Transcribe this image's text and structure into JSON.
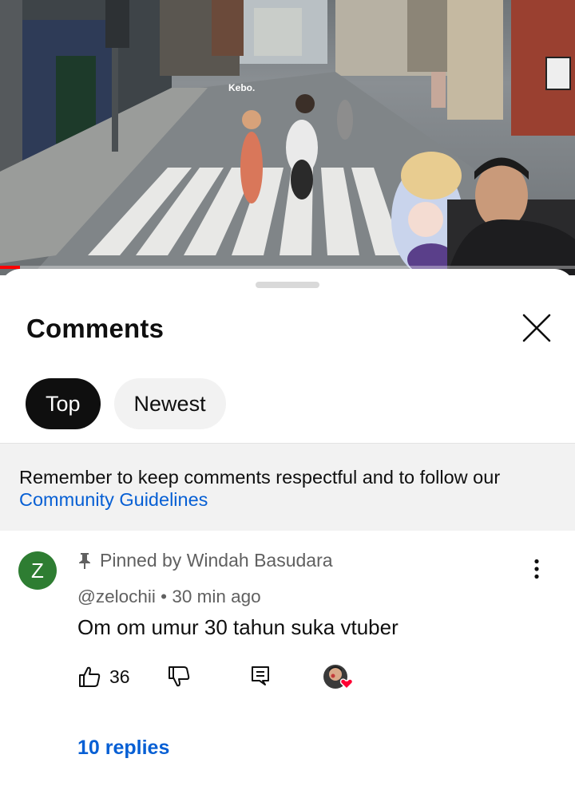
{
  "video": {
    "progress": 0.035,
    "overlay_tag": "Kebo."
  },
  "sheet": {
    "title": "Comments"
  },
  "filters": {
    "tabs": [
      {
        "label": "Top",
        "active": true
      },
      {
        "label": "Newest",
        "active": false
      }
    ]
  },
  "notice": {
    "text": "Remember to keep comments respectful and to follow our",
    "link": "Community Guidelines"
  },
  "comment": {
    "avatar_letter": "Z",
    "avatar_color": "#2e7d32",
    "pinned_label": "Pinned by Windah Basudara",
    "author": "@zelochii",
    "separator": "•",
    "time": "30 min ago",
    "text": "Om om umur 30 tahun suka vtuber",
    "like_count": "36",
    "replies_label": "10 replies"
  },
  "icons": {
    "close": "close-icon",
    "pin": "pin-icon",
    "more": "more-vert-icon",
    "like": "thumb-up-icon",
    "dislike": "thumb-down-icon",
    "reply": "comment-reply-icon",
    "creator_heart": "creator-heart-icon"
  },
  "colors": {
    "accent_link": "#065fd4",
    "progress": "#ff0000",
    "chip_active": "#0f0f0f",
    "chip_inactive": "#f2f2f2"
  }
}
